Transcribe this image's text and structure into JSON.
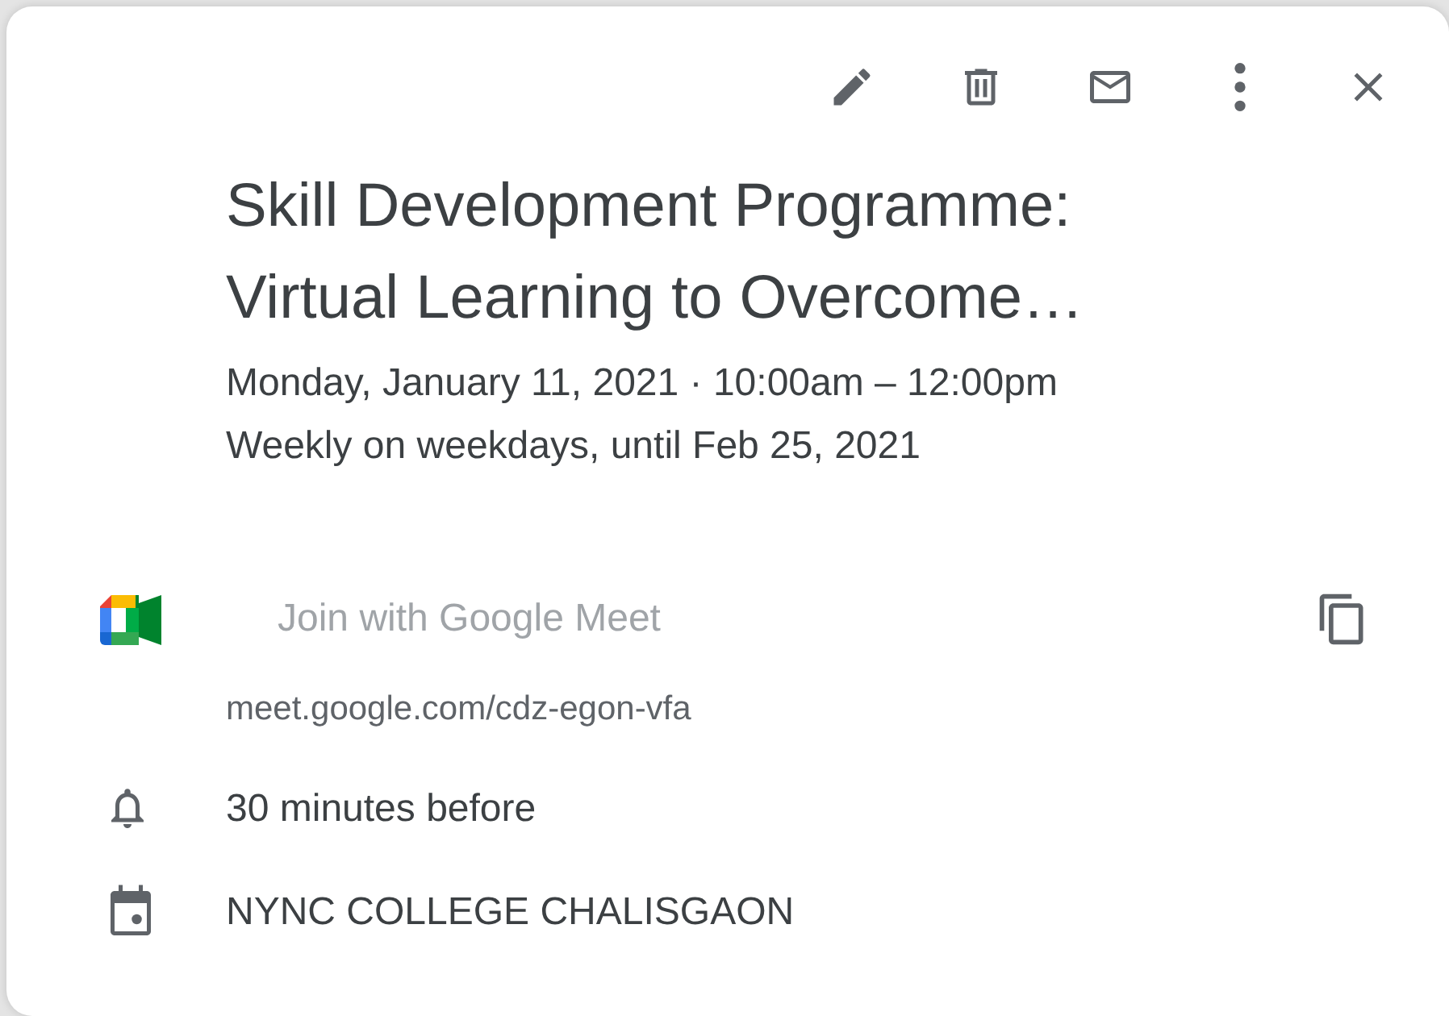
{
  "toolbar": {
    "buttons": [
      {
        "kind": "edit"
      },
      {
        "kind": "delete"
      },
      {
        "kind": "email"
      },
      {
        "kind": "more"
      },
      {
        "kind": "close"
      }
    ]
  },
  "event": {
    "title": "Skill Development Programme: Virtual Learning to Overcome…",
    "when": "Monday, January 11, 2021  ·  10:00am – 12:00pm",
    "recurrence": "Weekly on weekdays, until Feb 25, 2021"
  },
  "conference": {
    "join_label": "Join with Google Meet",
    "link": "meet.google.com/cdz-egon-vfa"
  },
  "reminder": "30 minutes before",
  "calendar": "NYNC COLLEGE CHALISGAON"
}
